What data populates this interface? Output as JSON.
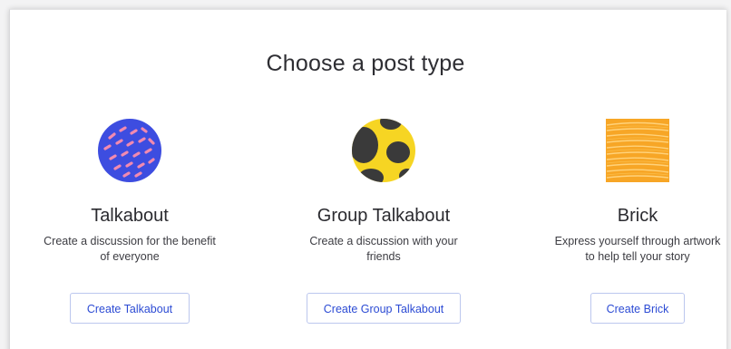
{
  "dialog": {
    "title": "Choose a post type"
  },
  "post_types": [
    {
      "icon": "blue-circle-confetti-icon",
      "title": "Talkabout",
      "description": "Create a discussion for the benefit of everyone",
      "button_label": "Create Talkabout"
    },
    {
      "icon": "yellow-circle-spots-icon",
      "title": "Group Talkabout",
      "description": "Create a discussion with your friends",
      "button_label": "Create Group Talkabout"
    },
    {
      "icon": "orange-square-stripes-icon",
      "title": "Brick",
      "description": "Express yourself through artwork to help tell your story",
      "button_label": "Create Brick"
    }
  ],
  "colors": {
    "accent": "#2c4bd4",
    "button_border": "#bcc7ee",
    "talkabout_blue": "#3d4de0",
    "talkabout_pink": "#f28ab0",
    "group_yellow": "#f6d523",
    "group_dark": "#3a3a3a",
    "brick_orange": "#f7a626",
    "brick_light": "#ffd27a"
  }
}
